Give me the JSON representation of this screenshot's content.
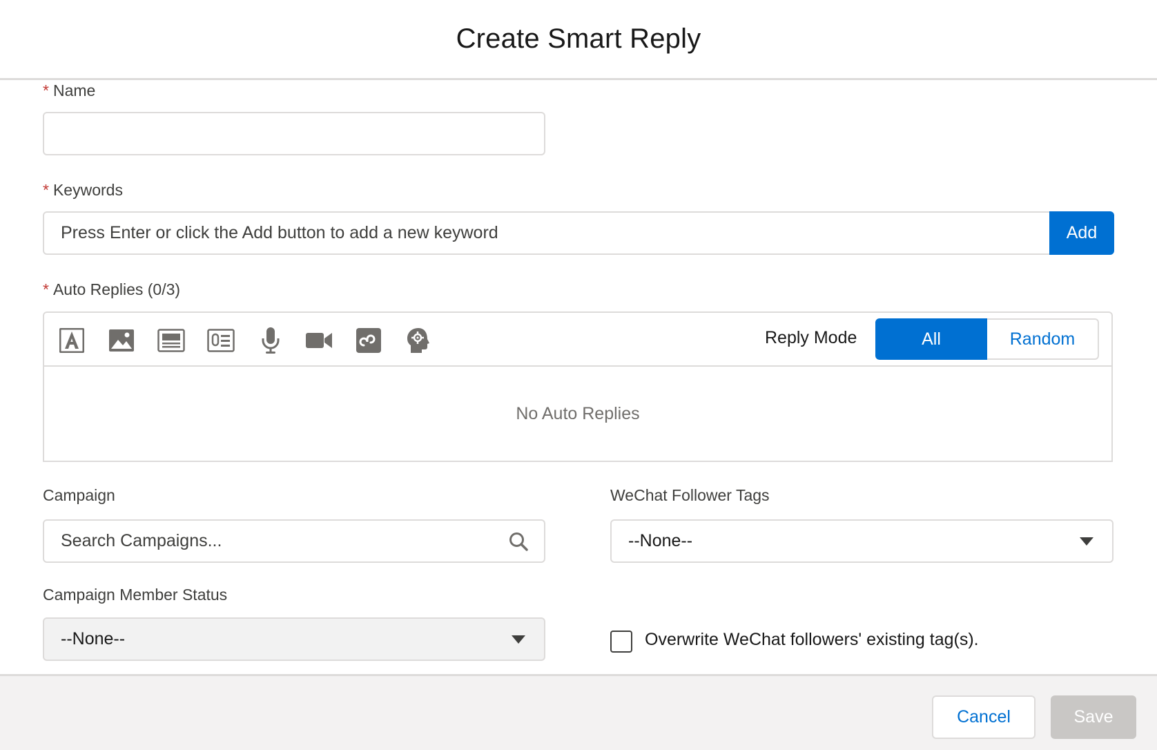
{
  "header": {
    "title": "Create Smart Reply"
  },
  "form": {
    "name": {
      "label": "Name",
      "required_mark": "*",
      "value": ""
    },
    "keywords": {
      "label": "Keywords",
      "required_mark": "*",
      "placeholder": "Press Enter or click the Add button to add a new keyword",
      "add_label": "Add"
    },
    "auto_replies": {
      "label": "Auto Replies (0/3)",
      "required_mark": "*",
      "toolbar_icons": [
        "text-icon",
        "image-icon",
        "news-icon",
        "link-card-icon",
        "microphone-icon",
        "video-icon",
        "mini-program-icon",
        "ai-head-icon"
      ],
      "reply_mode_label": "Reply Mode",
      "mode_all": "All",
      "mode_random": "Random",
      "selected_mode": "All",
      "empty_text": "No Auto Replies"
    },
    "campaign": {
      "label": "Campaign",
      "placeholder": "Search Campaigns..."
    },
    "follower_tags": {
      "label": "WeChat Follower Tags",
      "value": "--None--"
    },
    "member_status": {
      "label": "Campaign Member Status",
      "value": "--None--"
    },
    "overwrite": {
      "label": "Overwrite WeChat followers' existing tag(s).",
      "checked": false
    }
  },
  "footer": {
    "cancel_label": "Cancel",
    "save_label": "Save"
  },
  "colors": {
    "brand": "#0070d2",
    "required": "#c23934",
    "border": "#dddbda",
    "disabled": "#c9c7c5"
  }
}
